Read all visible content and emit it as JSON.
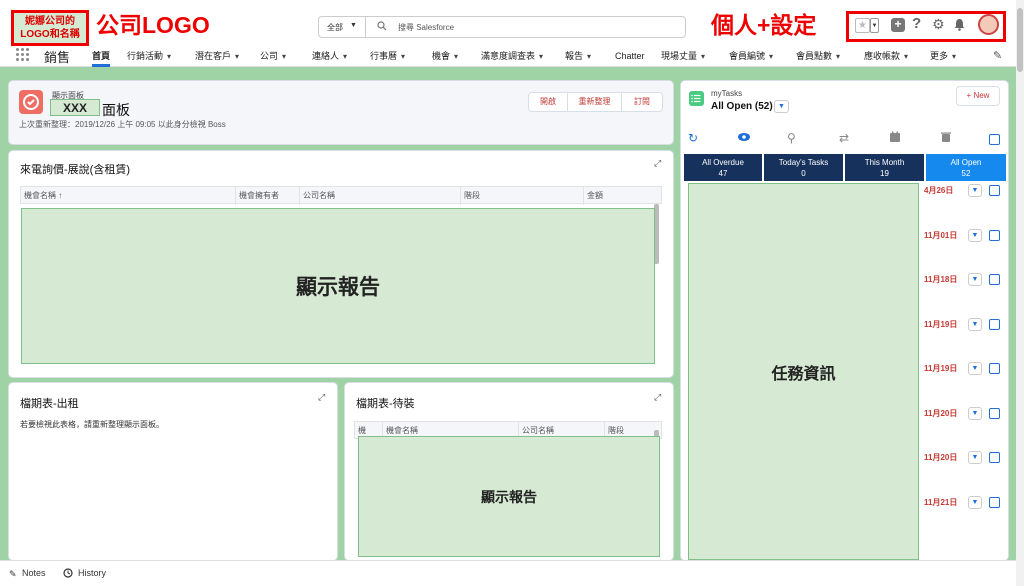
{
  "annotations": {
    "logo_box": "妮娜公司的\nLOGO和名稱",
    "company_logo": "公司LOGO",
    "personal_settings": "個人+設定",
    "report_display_1": "顯示報告",
    "report_display_2": "顯示報告",
    "task_info": "任務資訊",
    "dashboard_name_placeholder": "XXX"
  },
  "header": {
    "search_scope": "全部",
    "search_placeholder": "搜尋 Salesforce"
  },
  "app": {
    "name": "銷售"
  },
  "nav": {
    "items": [
      {
        "label": "首頁",
        "active": true,
        "dropdown": false
      },
      {
        "label": "行銷活動",
        "dropdown": true
      },
      {
        "label": "潛在客戶",
        "dropdown": true
      },
      {
        "label": "公司",
        "dropdown": true
      },
      {
        "label": "連絡人",
        "dropdown": true
      },
      {
        "label": "行事曆",
        "dropdown": true
      },
      {
        "label": "機會",
        "dropdown": true
      },
      {
        "label": "滿意度調查表",
        "dropdown": true
      },
      {
        "label": "報告",
        "dropdown": true
      },
      {
        "label": "Chatter",
        "dropdown": false
      },
      {
        "label": "現場丈量",
        "dropdown": true
      },
      {
        "label": "會員編號",
        "dropdown": true
      },
      {
        "label": "會員點數",
        "dropdown": true
      },
      {
        "label": "應收帳款",
        "dropdown": true
      },
      {
        "label": "更多",
        "dropdown": true
      }
    ]
  },
  "dashboard": {
    "type_label": "顯示面板",
    "title_suffix": "面板",
    "refresh_info": "上次重新整理：2019/12/26 上午 09:05 以此身分檢視 Boss",
    "buttons": {
      "open": "開啟",
      "refresh": "重新整理",
      "subscribe": "訂閱"
    }
  },
  "report1": {
    "title": "來電詢價-展說(含租賃)",
    "columns": [
      "機會名稱 ↑",
      "機會擁有者",
      "公司名稱",
      "階段",
      "金額"
    ]
  },
  "report2": {
    "title": "檔期表-出租",
    "message": "若要檢視此表格，請重新整理顯示面板。"
  },
  "report3": {
    "title": "檔期表-待裝",
    "columns": [
      "機",
      "機會名稱",
      "公司名稱",
      "階段"
    ]
  },
  "tasks": {
    "header_label": "myTasks",
    "view": "All Open (52)",
    "new_button": "+ New",
    "tabs": [
      {
        "label": "All Overdue",
        "count": "47"
      },
      {
        "label": "Today's Tasks",
        "count": "0"
      },
      {
        "label": "This Month",
        "count": "19"
      },
      {
        "label": "All Open",
        "count": "52",
        "active": true
      }
    ],
    "dates": [
      "4月26日",
      "11月01日",
      "11月18日",
      "11月19日",
      "11月19日",
      "11月20日",
      "11月20日",
      "11月21日"
    ]
  },
  "footer": {
    "notes": "Notes",
    "history": "History"
  },
  "colors": {
    "accent_blue": "#1589ee",
    "navy": "#16325c",
    "annotation_red": "#e00000",
    "annotation_green": "#d6ead3",
    "bg_green": "#9fd2a4"
  }
}
